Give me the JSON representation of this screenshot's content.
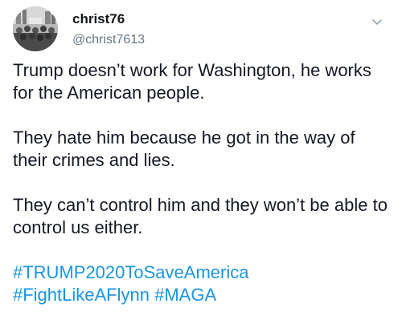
{
  "tweet": {
    "author": {
      "display_name": "christ76",
      "handle": "@christ7613",
      "avatar_icon": "crowd-photo-avatar"
    },
    "menu_icon": "chevron-down-icon",
    "paragraphs": [
      "Trump doesn’t work for Washington, he works for the American people.",
      "They hate him because he got in the way of their crimes and lies.",
      "They can’t control him and they won’t be able to control us either."
    ],
    "hashtags": [
      "#TRUMP2020ToSaveAmerica",
      "#FightLikeAFlynn",
      "#MAGA"
    ],
    "colors": {
      "text": "#141823",
      "secondary": "#657786",
      "link": "#1b95e0"
    }
  }
}
